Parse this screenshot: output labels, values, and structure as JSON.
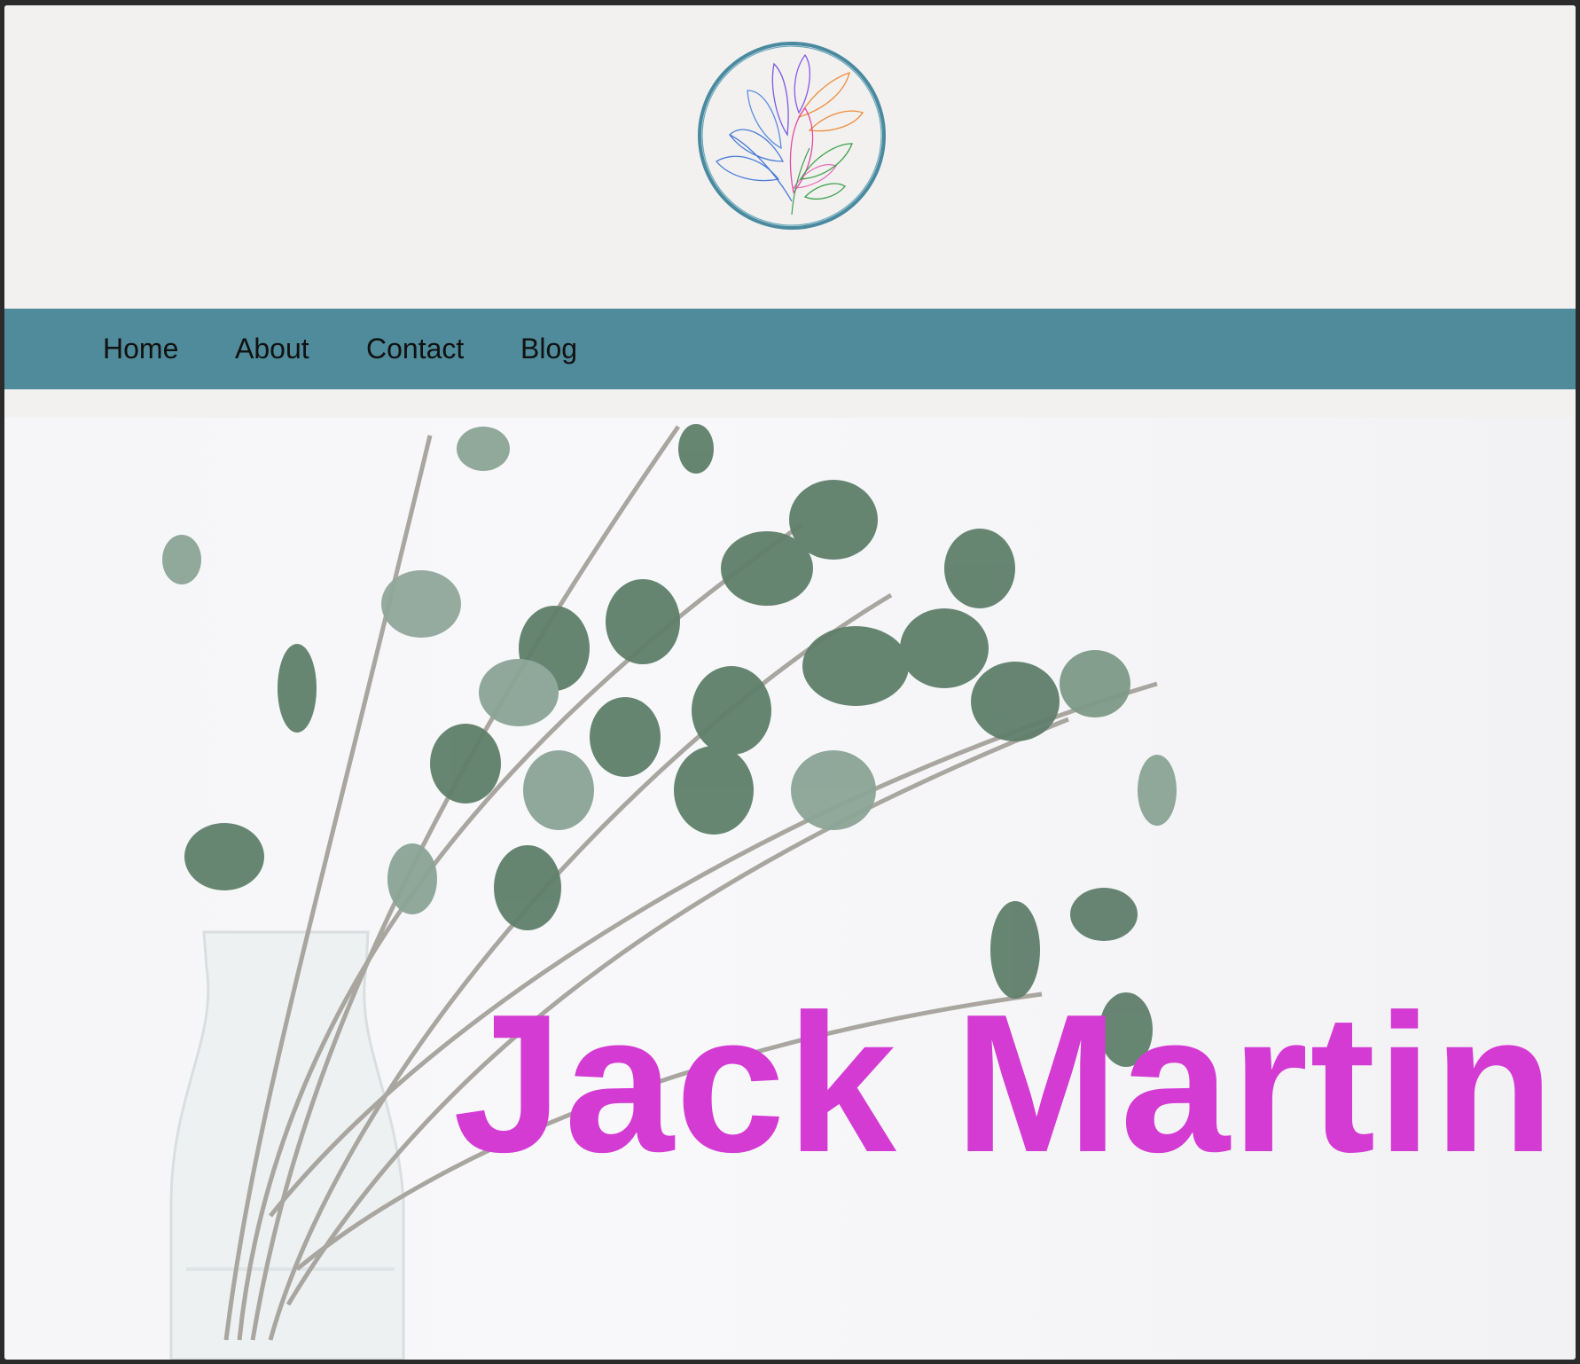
{
  "site": {
    "logo_icon": "botanical-leaves-logo-icon"
  },
  "nav": {
    "items": [
      {
        "label": "Home"
      },
      {
        "label": "About"
      },
      {
        "label": "Contact"
      },
      {
        "label": "Blog"
      }
    ]
  },
  "hero": {
    "title": "Jack Martin",
    "image_icon": "eucalyptus-vase-photo-icon"
  },
  "colors": {
    "header_bg": "#f2f1f0",
    "nav_bg": "#4f8b9a",
    "title": "#d33bd3"
  }
}
